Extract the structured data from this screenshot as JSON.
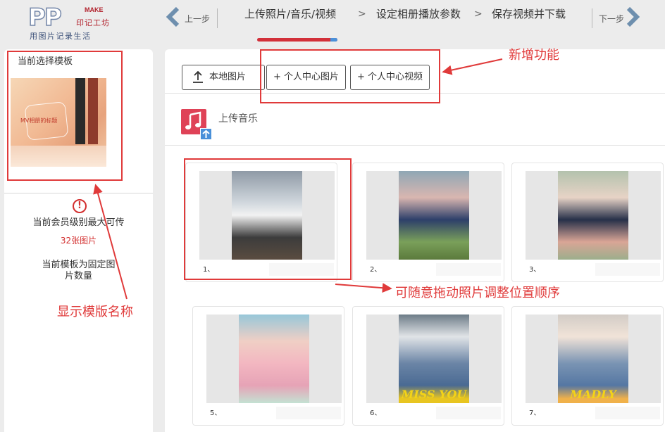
{
  "logo": {
    "letters": "PP",
    "make": "MAKE",
    "brand": "印记工坊",
    "tagline": "用图片记录生活"
  },
  "nav": {
    "prev_label": "上一步",
    "next_label": "下一步",
    "steps": [
      {
        "label": "上传照片/音乐/视频",
        "active": true
      },
      {
        "label": "设定相册播放参数",
        "active": false
      },
      {
        "label": "保存视频并下载",
        "active": false
      }
    ],
    "separator": ">"
  },
  "sidebar": {
    "title": "当前选择模板",
    "template_name": "MV相册的标题",
    "limit_text": "当前会员级别最大可传",
    "limit_value": "32张图片",
    "fixed_text_line1": "当前模板为固定图",
    "fixed_text_line2": "片数量"
  },
  "toolbar": {
    "local_label": "本地图片",
    "photo_label": "+ 个人中心图片",
    "video_label": "+ 个人中心视频"
  },
  "music": {
    "label": "上传音乐"
  },
  "photos": [
    {
      "index": "1、",
      "caption": ""
    },
    {
      "index": "2、",
      "caption": ""
    },
    {
      "index": "3、",
      "caption": ""
    },
    {
      "index": "5、",
      "caption": ""
    },
    {
      "index": "6、",
      "caption": "MISS YOU"
    },
    {
      "index": "7、",
      "caption": "MADLY"
    }
  ],
  "annotations": {
    "new_feature": "新增功能",
    "template_name": "显示模版名称",
    "drag_hint": "可随意拖动照片调整位置顺序"
  },
  "colors": {
    "accent_red": "#d2303a",
    "annotation_red": "#e03a3a",
    "link_blue": "#4a90d9",
    "music_red": "#df4257"
  }
}
